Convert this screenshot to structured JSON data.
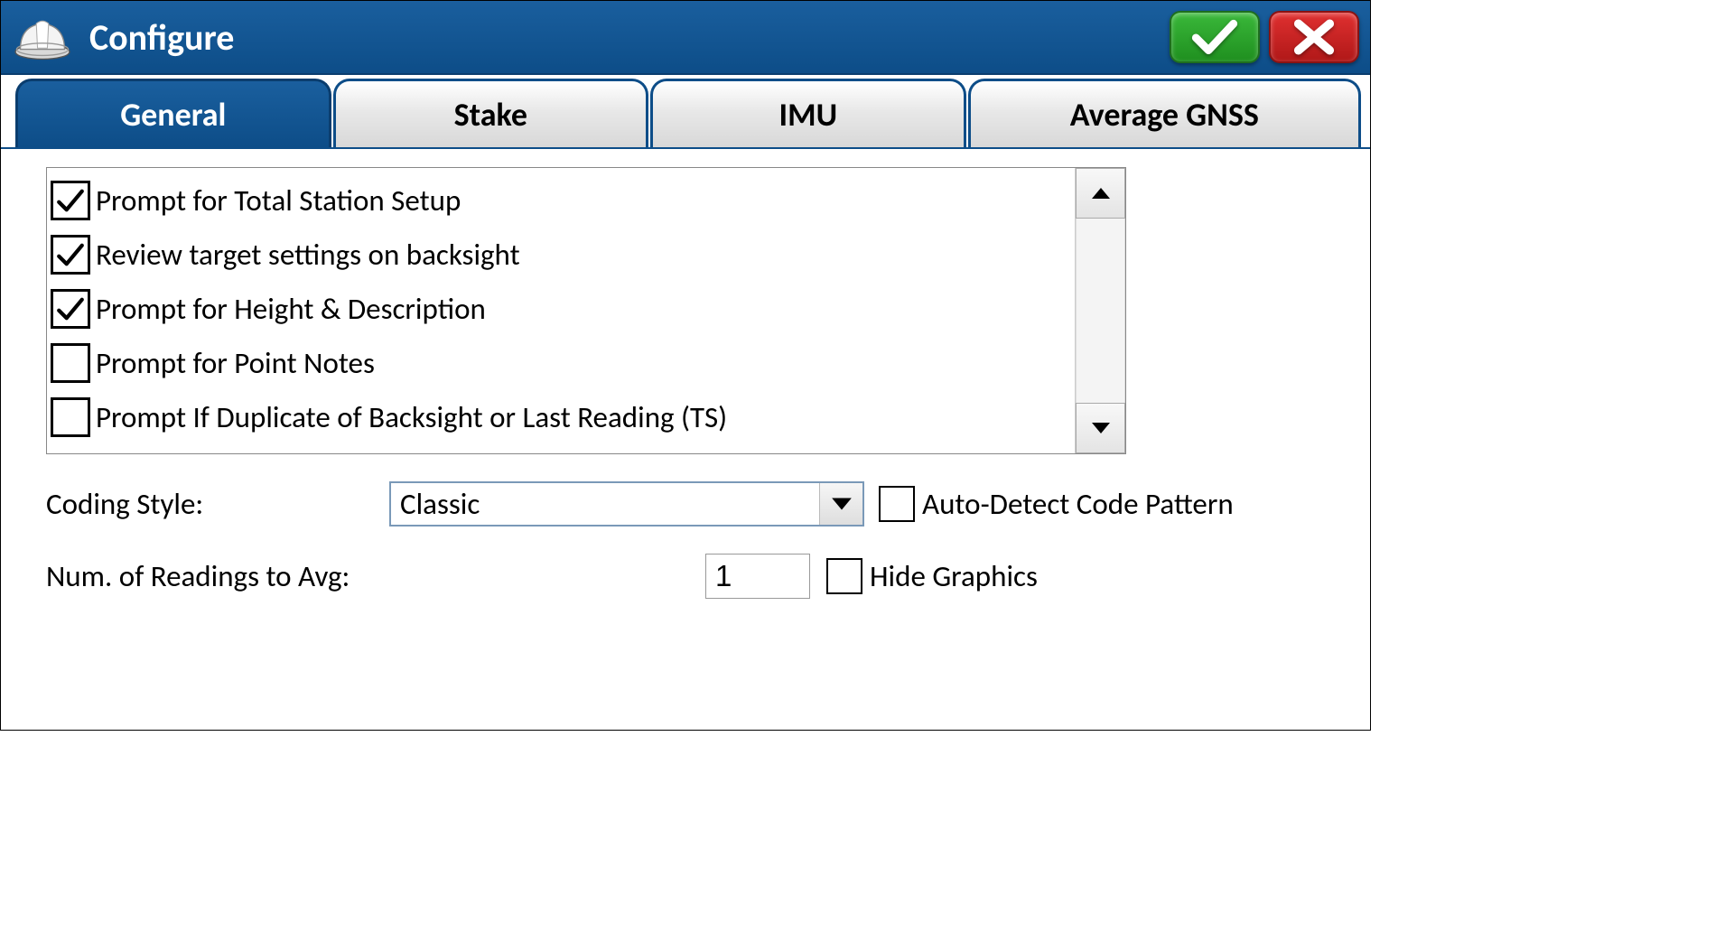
{
  "header": {
    "title": "Configure"
  },
  "tabs": [
    {
      "label": "General",
      "active": true
    },
    {
      "label": "Stake",
      "active": false
    },
    {
      "label": "IMU",
      "active": false
    },
    {
      "label": "Average GNSS",
      "active": false
    }
  ],
  "options": [
    {
      "label": "Prompt for Total Station Setup",
      "checked": true
    },
    {
      "label": "Review target settings on backsight",
      "checked": true
    },
    {
      "label": "Prompt for Height & Description",
      "checked": true
    },
    {
      "label": "Prompt for Point Notes",
      "checked": false
    },
    {
      "label": "Prompt If Duplicate of Backsight or Last Reading (TS)",
      "checked": false
    }
  ],
  "codingStyle": {
    "label": "Coding Style:",
    "value": "Classic"
  },
  "autoDetect": {
    "label": "Auto-Detect Code Pattern",
    "checked": false
  },
  "numReadings": {
    "label": "Num. of Readings to Avg:",
    "value": "1"
  },
  "hideGraphics": {
    "label": "Hide Graphics",
    "checked": false
  }
}
